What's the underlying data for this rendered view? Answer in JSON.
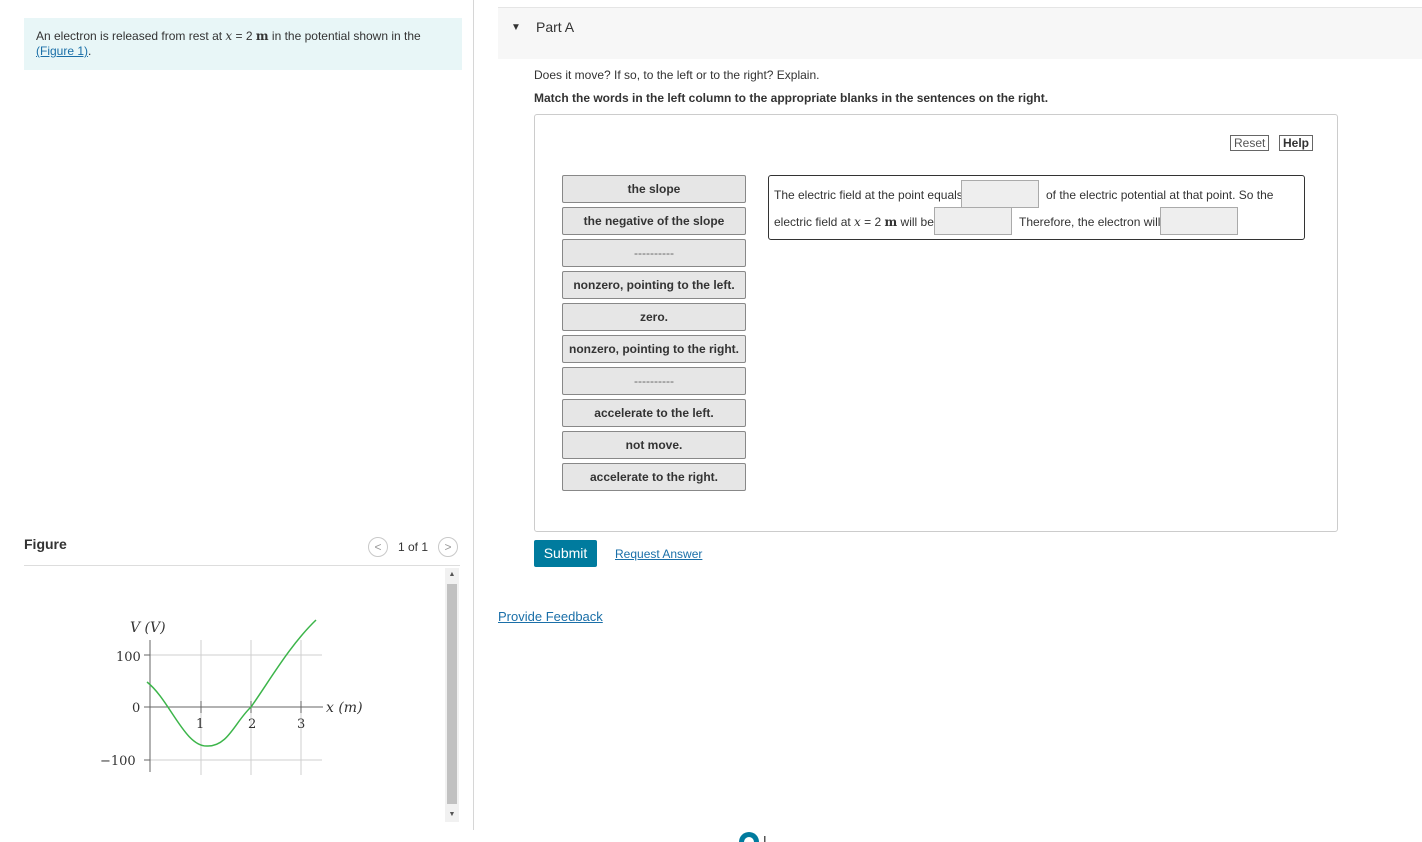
{
  "problem": {
    "text_before": "An electron is released from rest at ",
    "var_x": "x",
    "eq": " = 2 ",
    "unit_m": "m",
    "text_after": " in the potential shown in the",
    "figure_link": "(Figure 1)",
    "period": "."
  },
  "figure_panel": {
    "label": "Figure",
    "pager_text": "1 of 1",
    "prev_glyph": "<",
    "next_glyph": ">"
  },
  "graph": {
    "y_axis_label": "V (V)",
    "x_axis_label": "x (m)",
    "y_ticks": [
      "100",
      "0",
      "−100"
    ],
    "x_ticks": [
      "1",
      "2",
      "3"
    ],
    "curve_color": "#3cb54a"
  },
  "part": {
    "caret": "▼",
    "title": "Part A",
    "question": "Does it move? If so, to the left or to the right? Explain.",
    "instructions": "Match the words in the left column to the appropriate blanks in the sentences on the right."
  },
  "toolbar": {
    "reset_label": "Reset",
    "help_label": "Help"
  },
  "tiles": [
    "the slope",
    "the negative of the slope",
    "----------",
    "nonzero, pointing to the left.",
    "zero.",
    "nonzero, pointing to the right.",
    "----------",
    "accelerate to the left.",
    "not move.",
    "accelerate to the right."
  ],
  "sentence": {
    "part1": "The electric field at the point equals",
    "part2": "of the electric potential at that point. So the",
    "part3_a": "electric field at ",
    "part3_var": "x",
    "part3_b": " = 2 ",
    "part3_unit": "m",
    "part3_c": " will be",
    "part4": "Therefore, the electron will"
  },
  "actions": {
    "submit_label": "Submit",
    "request_answer_label": "Request Answer",
    "feedback_label": "Provide Feedback"
  },
  "colors": {
    "accent": "#007b9e",
    "link": "#1a6fa8",
    "problem_bg": "#e8f6f7"
  }
}
